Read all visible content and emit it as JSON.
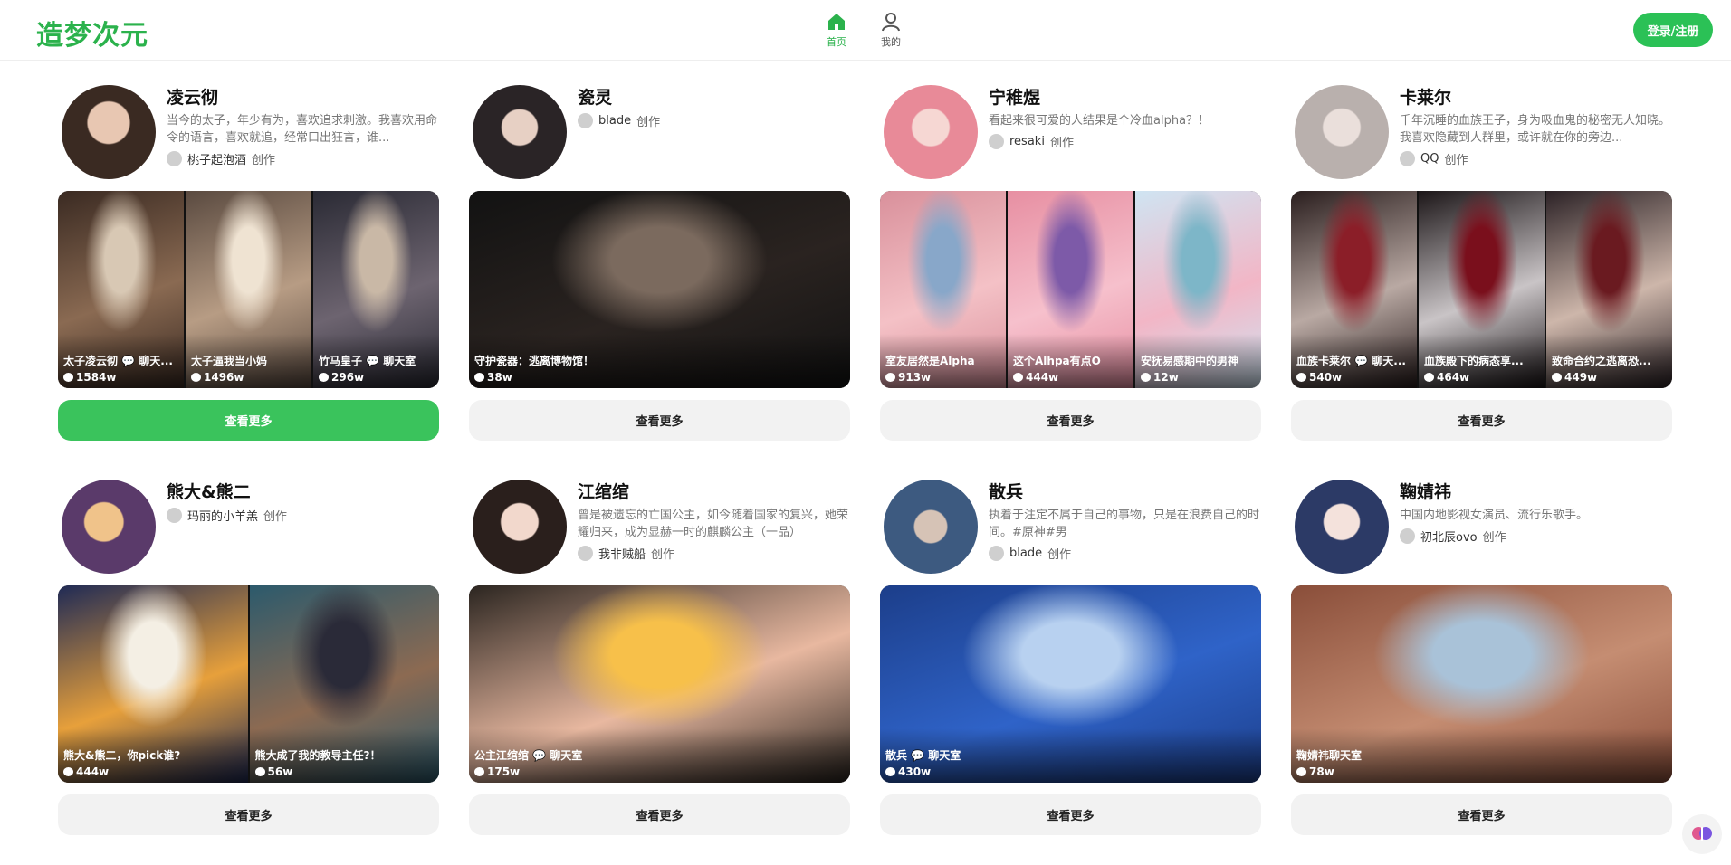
{
  "app": {
    "logo": "造梦次元",
    "login_label": "登录/注册"
  },
  "nav": [
    {
      "label": "首页",
      "icon": "home-icon",
      "active": true
    },
    {
      "label": "我的",
      "icon": "user-icon",
      "active": false
    }
  ],
  "colors": {
    "accent": "#2bb24c",
    "button_green": "#3ac35c"
  },
  "cards": [
    {
      "name": "凌云彻",
      "desc": "当今的太子，年少有为，喜欢追求刺激。我喜欢用命令的语言，喜欢就追，经常口出狂言，谁...",
      "creator": "桃子起泡酒",
      "creator_suffix": "创作",
      "more_label": "查看更多",
      "thumbs": [
        {
          "caption": "太子凌云彻 💬 聊天...",
          "count": "1584w"
        },
        {
          "caption": "太子逼我当小妈",
          "count": "1496w"
        },
        {
          "caption": "竹马皇子 💬 聊天室",
          "count": "296w"
        }
      ]
    },
    {
      "name": "瓷灵",
      "desc": "",
      "creator": "blade",
      "creator_suffix": "创作",
      "more_label": "查看更多",
      "thumbs": [
        {
          "caption": "守护瓷器：逃离博物馆！",
          "count": "38w"
        }
      ]
    },
    {
      "name": "宁稚煜",
      "desc": "看起来很可爱的人结果是个冷血alpha？！",
      "creator": "resaki",
      "creator_suffix": "创作",
      "more_label": "查看更多",
      "thumbs": [
        {
          "caption": "室友居然是Alpha",
          "count": "913w"
        },
        {
          "caption": "这个Alhpa有点O",
          "count": "444w"
        },
        {
          "caption": "安抚易感期中的男神",
          "count": "12w"
        }
      ]
    },
    {
      "name": "卡莱尔",
      "desc": "千年沉睡的血族王子，身为吸血鬼的秘密无人知晓。我喜欢隐藏到人群里，或许就在你的旁边...",
      "creator": "QQ",
      "creator_suffix": "创作",
      "more_label": "查看更多",
      "thumbs": [
        {
          "caption": "血族卡莱尔 💬 聊天...",
          "count": "540w"
        },
        {
          "caption": "血族殿下的病态享...",
          "count": "464w"
        },
        {
          "caption": "致命合约之逃离恐...",
          "count": "449w"
        }
      ]
    },
    {
      "name": "熊大&熊二",
      "desc": "",
      "creator": "玛丽的小羊羔",
      "creator_suffix": "创作",
      "more_label": "查看更多",
      "thumbs": [
        {
          "caption": "熊大&熊二，你pick谁?",
          "count": "444w"
        },
        {
          "caption": "熊大成了我的教导主任?！",
          "count": "56w"
        }
      ]
    },
    {
      "name": "江绾绾",
      "desc": "曾是被遗忘的亡国公主，如今随着国家的复兴，她荣耀归来，成为显赫一时的麒麟公主（一品）",
      "creator": "我非贼船",
      "creator_suffix": "创作",
      "more_label": "查看更多",
      "thumbs": [
        {
          "caption": "公主江绾绾 💬 聊天室",
          "count": "175w"
        }
      ]
    },
    {
      "name": "散兵",
      "desc": "执着于注定不属于自己的事物，只是在浪费自己的时间。#原神#男",
      "creator": "blade",
      "creator_suffix": "创作",
      "more_label": "查看更多",
      "thumbs": [
        {
          "caption": "散兵 💬 聊天室",
          "count": "430w"
        }
      ]
    },
    {
      "name": "鞠婧祎",
      "desc": "中国内地影视女演员、流行乐歌手。",
      "creator": "初北辰ovo",
      "creator_suffix": "创作",
      "more_label": "查看更多",
      "thumbs": [
        {
          "caption": "鞠婧祎聊天室",
          "count": "78w"
        }
      ]
    }
  ]
}
